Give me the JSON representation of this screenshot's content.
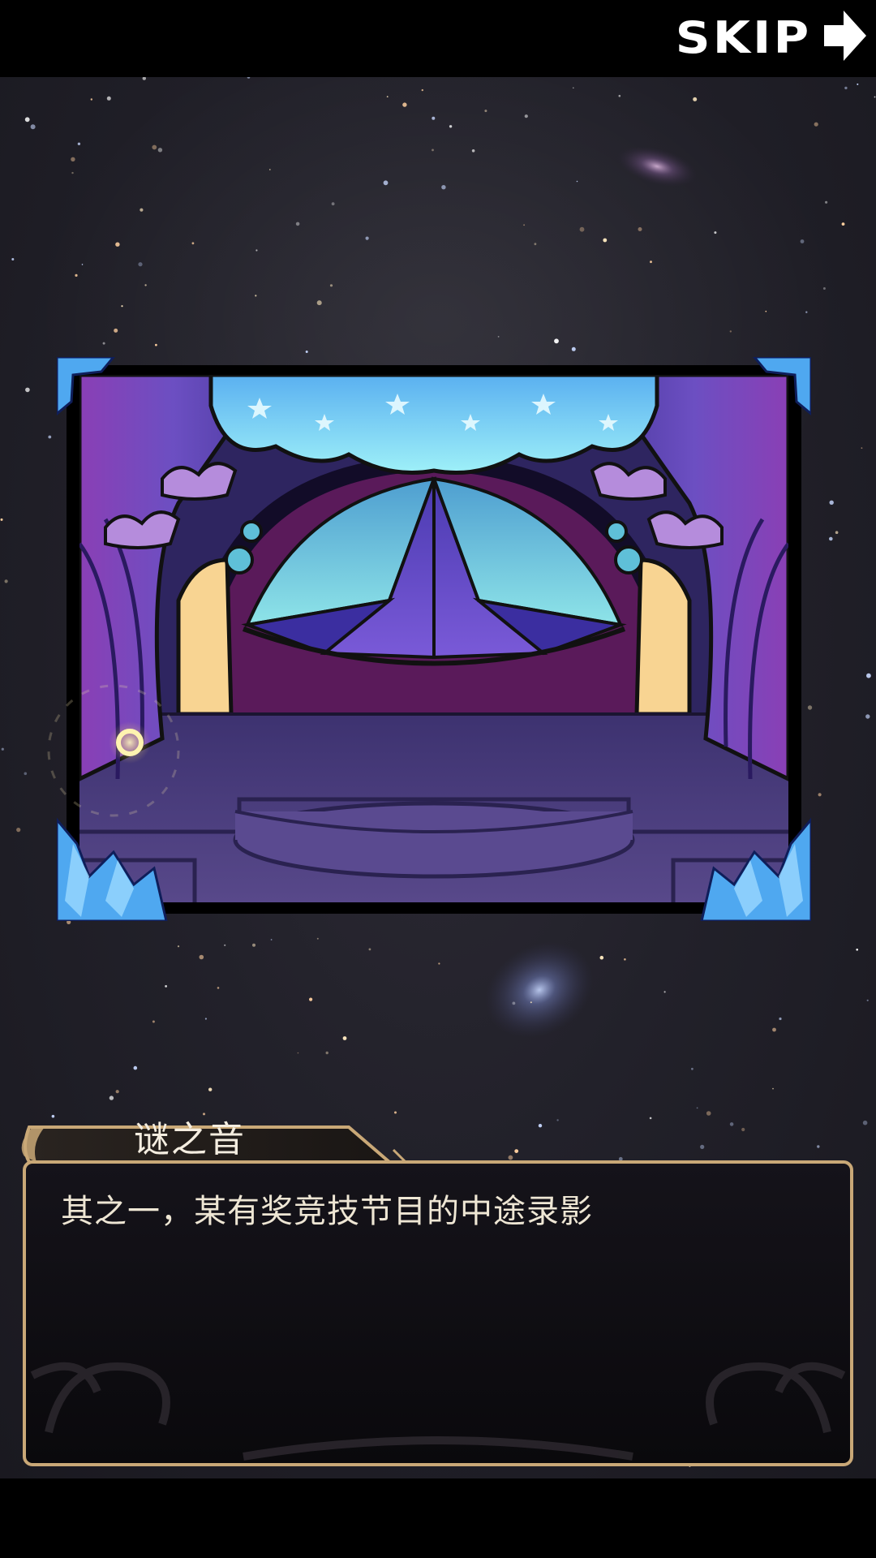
{
  "topbar": {
    "skip_label": "SKIP",
    "skip_icon": "arrow-right-icon"
  },
  "scene": {
    "background": "starfield",
    "image": "stage-curtain-illustration"
  },
  "dialog": {
    "speaker": "谜之音",
    "text": "其之一，某有奖竞技节目的中途录影"
  },
  "colors": {
    "background": "#000000",
    "space": "#24232b",
    "frame_gold": "#c9a877",
    "text_light": "#eee6d4",
    "curtain_purple": "#6b4fc0",
    "valance_cyan": "#7fd8f0",
    "stage_floor": "#4c3e78",
    "crystal_blue": "#4fa8f0"
  }
}
